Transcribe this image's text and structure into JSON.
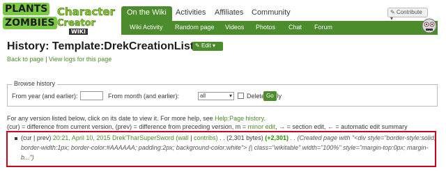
{
  "logo": {
    "plants": "PLANTS",
    "zombies": "ZOMBIES",
    "character": "Character",
    "creator": "Creator",
    "wiki": "WIKI"
  },
  "nav": {
    "tabs": [
      "On the Wiki",
      "Activities",
      "Affiliates",
      "Community"
    ],
    "sub": [
      "Wiki Activity",
      "Random page",
      "Videos",
      "Photos",
      "Chat",
      "Forum"
    ],
    "contribute": "Contribute"
  },
  "page": {
    "title": "History:  Template:DrekCreationList",
    "edit": "Edit",
    "back": "Back to page",
    "sep": "|",
    "view_logs": "View logs for this page"
  },
  "browse": {
    "legend": "Browse history",
    "from_year": "From year (and earlier):",
    "from_month": "From month (and earlier):",
    "month_value": "all",
    "deleted": "Deleted only",
    "go": "Go"
  },
  "info": {
    "line1_a": "For any version listed below, click on its date to view it. For more help, see ",
    "line1_link": "Help:Page history",
    "line1_b": ".",
    "line2_a": "(cur) = difference from current version, (prev) = difference from preceding version, m = ",
    "line2_link": "minor edit",
    "line2_b": ", → = section edit, ← = automatic edit summary"
  },
  "entry": {
    "cur_prev": "(cur | prev)",
    "date": "20:21, April 10, 2015",
    "user": "Drek'TharSuperSword",
    "wall": "(wall",
    "sep": "|",
    "contribs": "contribs)",
    "size": ". . (2,301 bytes)",
    "delta": "(+2,301)",
    "summary1": ". . (Created page with \"<div style=\"border-style:solid;",
    "summary2": "border-width:1px; border-color:#AAAAAA; padding:2px; background-color:white\"> {| class=\"wikitable\" width=\"100%\" style=\"margin-top:0px; margin-",
    "summary3": "b...\")"
  }
}
